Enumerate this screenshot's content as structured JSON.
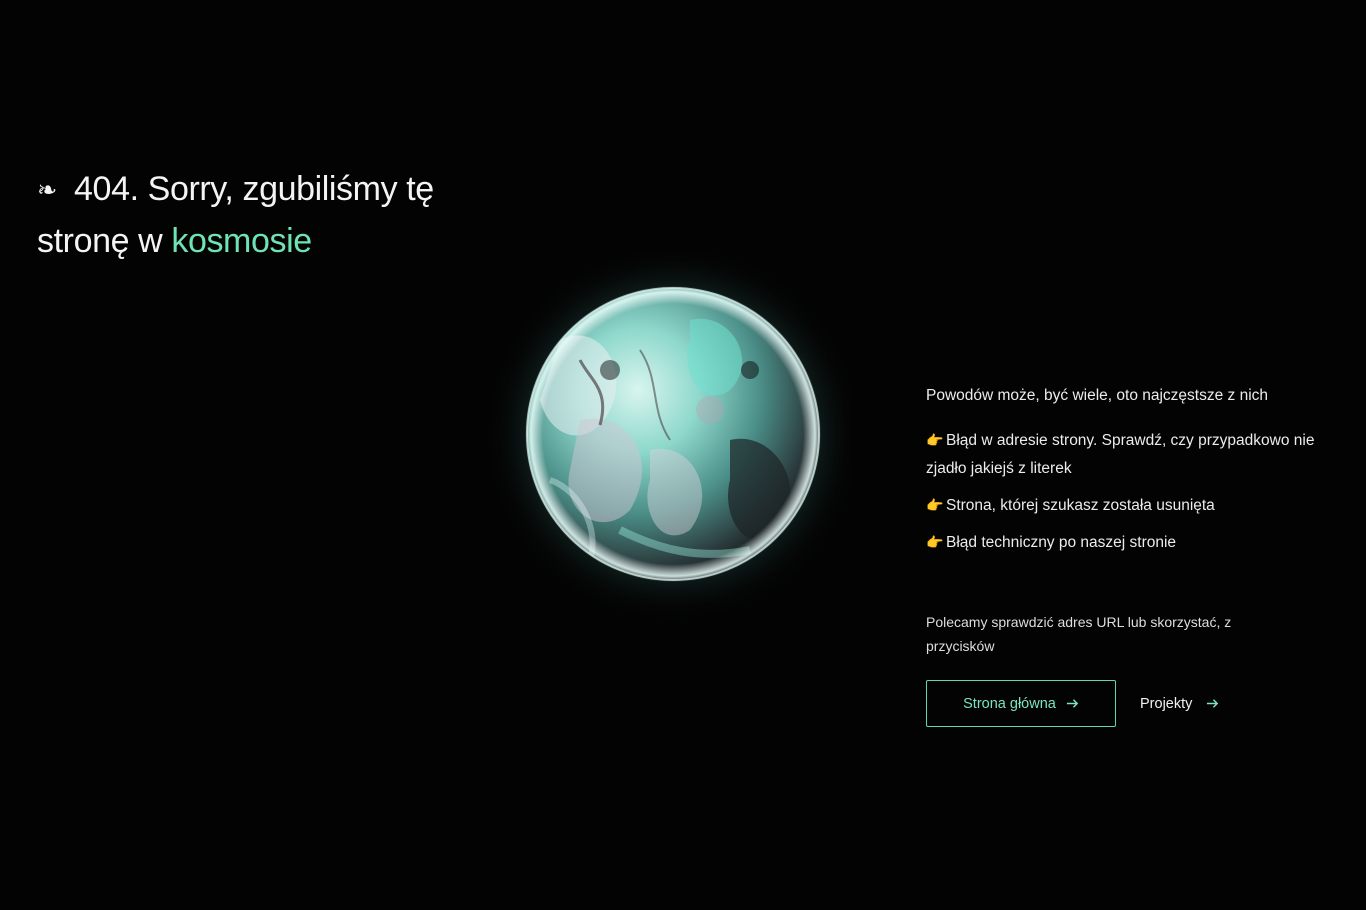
{
  "heading": {
    "icon": "floral-heart-icon",
    "icon_glyph": "❧",
    "text_before": "404. Sorry, zgubiliśmy tę stronę w",
    "accent_text": "kosmosie"
  },
  "colors": {
    "accent": "#6fe2b6",
    "background": "#030303",
    "pointer_emoji": "#f1b52b"
  },
  "reasons": {
    "intro": "Powodów może, być wiele, oto najczęstsze z nich",
    "pointer_icon": "pointing-hand-icon",
    "pointer_glyph": "👉",
    "items": [
      "Błąd w adresie strony. Sprawdź, czy przypadkowo nie zjadło jakiejś z literek",
      "Strona, której szukasz została usunięta",
      "Błąd techniczny po naszej stronie"
    ]
  },
  "recommend_text": "Polecamy sprawdzić adres URL lub skorzystać, z przycisków",
  "buttons": {
    "home_label": "Strona główna",
    "projects_label": "Projekty",
    "arrow_icon": "arrow-right-icon"
  }
}
